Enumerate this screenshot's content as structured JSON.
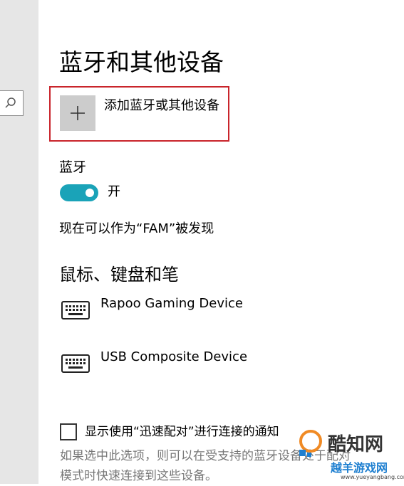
{
  "page": {
    "title": "蓝牙和其他设备"
  },
  "add_device": {
    "label": "添加蓝牙或其他设备",
    "icon": "plus-icon"
  },
  "bluetooth": {
    "section_label": "蓝牙",
    "toggle_state": "开",
    "toggle_on": true,
    "discoverable_text": "现在可以作为“FAM”被发现"
  },
  "input_devices": {
    "heading": "鼠标、键盘和笔",
    "devices": [
      {
        "name": "Rapoo Gaming Device",
        "icon": "keyboard-icon"
      },
      {
        "name": "USB Composite Device",
        "icon": "keyboard-icon"
      }
    ]
  },
  "swift_pair": {
    "checked": false,
    "label": "显示使用“迅速配对”进行连接的通知",
    "description_lines": [
      "如果选中此选项，则可以在受支持的蓝牙设备处于配对",
      "模式时快速连接到这些设备。"
    ]
  },
  "watermark": {
    "brand": "酷知网",
    "site": "越羊游戏网",
    "url": "www.yueyangbang.com"
  },
  "colors": {
    "accent": "#1aa3b8",
    "highlight_frame": "#c9242b",
    "sidebar_bg": "#e6e6e6",
    "tile_bg": "#cccccc",
    "muted_text": "#777777"
  }
}
